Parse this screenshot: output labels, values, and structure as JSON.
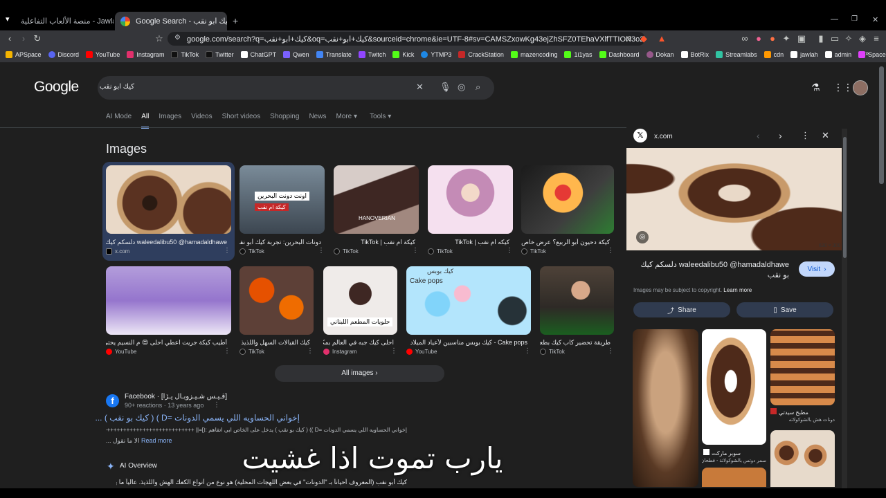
{
  "tabs": [
    {
      "title": "جولة | Jawlah - منصة الألعاب التفاعلية",
      "active": false
    },
    {
      "title": "كيك ابو نقب - Google Search",
      "active": true
    }
  ],
  "url": "google.com/search?q=كيك+ابو+نقب&oq=كيك+ابو+نقب&sourceid=chrome&ie=UTF-8#sv=CAMSZxowKg43ejZhSFZ0TEhaVXlfTTION3o2YUhWdExlWl...",
  "bookmarks": [
    "APSpace",
    "Discord",
    "YouTube",
    "Instagram",
    "TikTok",
    "Twitter",
    "ChatGPT",
    "Qwen",
    "Translate",
    "Twitch",
    "Kick",
    "YTMP3",
    "CrackStation",
    "mazencoding",
    "1i1yas",
    "Dashboard",
    "Dokan",
    "BotRix",
    "Streamlabs",
    "cdn",
    "jawlah",
    "admin",
    "Spacemail"
  ],
  "google": {
    "logo": "Google",
    "query": "كيك ابو نقب",
    "nav": [
      "AI Mode",
      "All",
      "Images",
      "Videos",
      "Short videos",
      "Shopping",
      "News",
      "More",
      "Tools"
    ],
    "images_title": "Images",
    "all_images": "All images"
  },
  "images_row1": [
    {
      "caption": "waleedalibu50 @hamadaldhawe دلسكم كيك",
      "source": "x.com"
    },
    {
      "caption": "دونات البحرين: تجربة كيك أبو نقب ا",
      "source": "TikTok"
    },
    {
      "caption": "كيكة ام نقب | TikTok",
      "source": "TikTok"
    },
    {
      "caption": "كيكه ام نقب | TikTok",
      "source": "TikTok"
    },
    {
      "caption": "كيكة دحيون أبو الربيع؟ عرض خاص الساعة",
      "source": "TikTok"
    }
  ],
  "images_row2": [
    {
      "caption": "أطيب كيكة جريت اعطي احلى 😍 م النسيم يحتي يتعمل حلويات مع أولادنا",
      "source": "YouTube"
    },
    {
      "caption": "كيك القيالات السهل واللذيذ",
      "source": "TikTok"
    },
    {
      "caption": "احلى كيك جبه في العالم بمكونات...",
      "source": "Instagram"
    },
    {
      "caption": "Cake pops - كيك بوبس مناسبين لأعياد الميلاد",
      "source": "YouTube"
    },
    {
      "caption": "طريقة تحضير كاب كيك بطعم لوتر...",
      "source": "TikTok"
    }
  ],
  "image_overlay_texts": {
    "img2_top": "اونت دونت البحرين",
    "img2_badge": "كيكة ام نقب",
    "img3": "HANOVERIAN",
    "img4_cake": "كيك بوبس",
    "img4_sub": "Cake pops",
    "img3_row2": "حلويات المطعم اللبناني"
  },
  "result": {
    "site": "Facebook",
    "site_extra": "[قـيـس شـيـزوبـال يـڒا]",
    "meta": "90+ reactions · 13 years ago",
    "title": "إخواني الحساويه اللي يسمي الدونات =D ) ( كيك بو نقب ) ...",
    "snippet": "إخواني الحساويه اللي يسمي الدونات =D )) ( كيك بو نقب ) يدخل على الخاص ابي اتفاهم :(]=|| +++++++++++++++++++++++++++++++++",
    "snippet2": "الا ما نقول ...",
    "read_more": "Read more"
  },
  "ai_overview": {
    "label": "AI Overview",
    "text": "كيك أبو نقب (المعروف أحياناً بـ \"الدونات\" في بعض اللهجات المحلية) هو نوع من أنواع الكعك الهش واللذيذ. عالياً ما يتميز"
  },
  "subtitle": "يارب تموت اذا غشيت",
  "panel": {
    "source": "x.com",
    "size": "630 × 300",
    "title": "waleedalibu50 @hamadaldhawe دلسكم كيك بو نقب",
    "visit": "Visit",
    "copyright": "Images may be subject to copyright.",
    "learn_more": "Learn more",
    "share": "Share",
    "save": "Save",
    "related": [
      {
        "store": "مطبخ سيدتي",
        "label": "دونات هش بالشوكولاته"
      },
      {
        "store": "سوبر ماركت",
        "label": "سمر دوتس بالشوكولاتة - فطحان"
      }
    ]
  }
}
